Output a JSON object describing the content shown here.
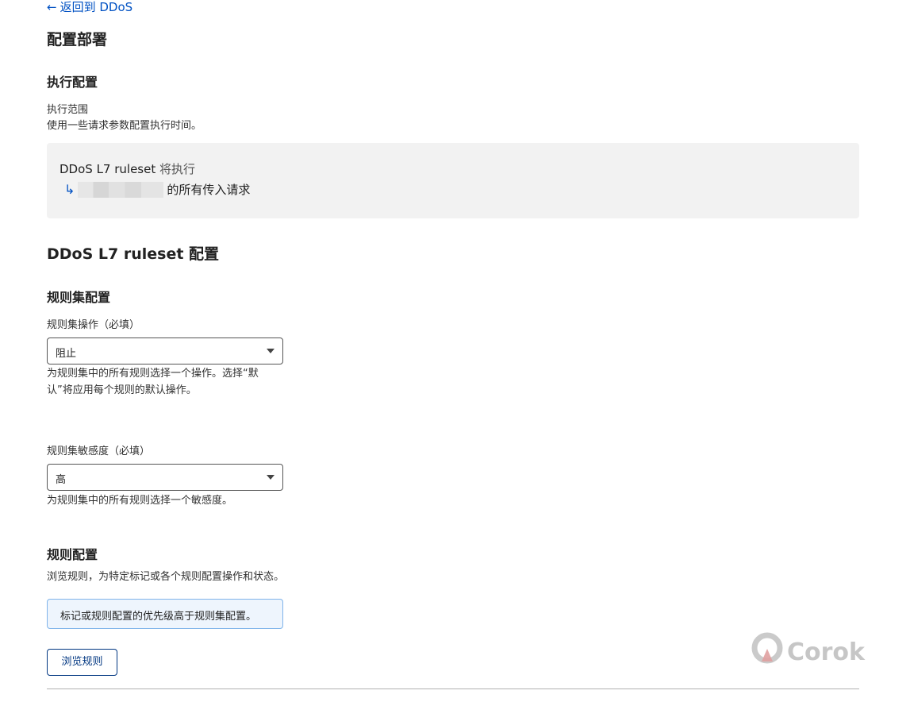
{
  "back_link": {
    "arrow": "←",
    "label": "返回到 DDoS"
  },
  "page_title": "配置部署",
  "execution": {
    "heading": "执行配置",
    "scope_label": "执行范围",
    "scope_desc": "使用一些请求参数配置执行时间。",
    "scope_ruleset": "DDoS L7 ruleset",
    "scope_verb": "将执行",
    "scope_branch": "↳",
    "scope_target_suffix": "的所有传入请求"
  },
  "ruleset_section_title": "DDoS L7 ruleset 配置",
  "ruleset_config": {
    "heading": "规则集配置",
    "action_label": "规则集操作（必填）",
    "action_value": "阻止",
    "action_help": "为规则集中的所有规则选择一个操作。选择“默认”将应用每个规则的默认操作。",
    "sensitivity_label": "规则集敏感度（必填）",
    "sensitivity_value": "高",
    "sensitivity_help": "为规则集中的所有规则选择一个敏感度。"
  },
  "rule_config": {
    "heading": "规则配置",
    "desc": "浏览规则，为特定标记或各个规则配置操作和状态。",
    "info": "标记或规则配置的优先级高于规则集配置。",
    "browse_button": "浏览规则"
  },
  "watermark": {
    "text": "Corok"
  },
  "colors": {
    "link": "#0051c3",
    "button_border": "#003681",
    "info_bg": "#eef5fd",
    "info_border": "#7eb3ea",
    "scope_bg": "#f2f2f2"
  }
}
